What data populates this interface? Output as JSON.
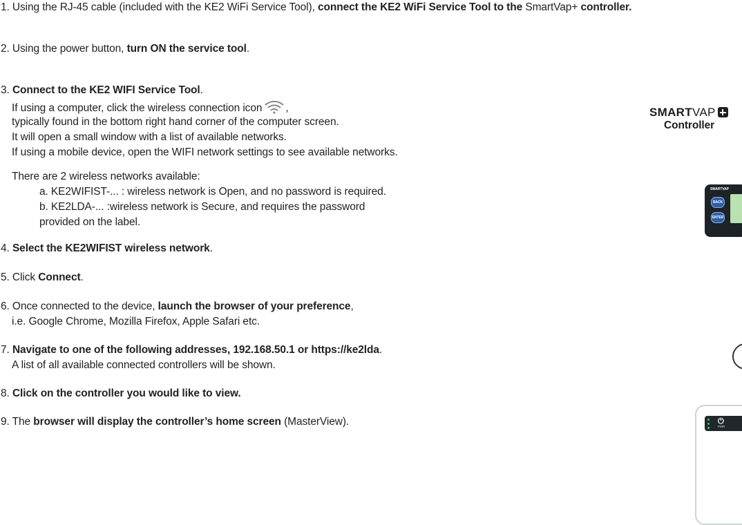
{
  "steps": {
    "s1": {
      "a": "1. Using the RJ-45 cable (included with the KE2 WiFi Service Tool), ",
      "b": "connect the KE2 WiFi Service Tool to the",
      "c": " SmartVap+ ",
      "d": "controller."
    },
    "s2": {
      "a": "2. Using the power button, ",
      "b": "turn ON the service tool",
      "c": "."
    },
    "s3": {
      "num": "3. ",
      "title": "Connect to the KE2 WIFI Service Tool",
      "title_end": ".",
      "p1a": "If using a computer, click the wireless connection icon",
      "p1b": ",",
      "p2": "typically found in the bottom right hand corner of the computer screen.",
      "p3": "It will open a small window with a list of available networks.",
      "p4": "If using a mobile device, open the WIFI network settings to see available networks.",
      "p5": "There are 2 wireless networks available:",
      "opt_a": "a.  KE2WIFIST-... : wireless network is Open, and no password is required.",
      "opt_b": "b.  KE2LDA-... :wireless network is Secure, and requires the password",
      "opt_b2": "provided on the label."
    },
    "s4": {
      "a": "4. ",
      "b": "Select the KE2WIFIST wireless network",
      "c": "."
    },
    "s5": {
      "a": "5. Click ",
      "b": "Connect",
      "c": "."
    },
    "s6": {
      "a": "6. Once connected to the device, ",
      "b": "launch the browser of your preference",
      "c": ",",
      "l2": "i.e. Google Chrome, Mozilla Firefox, Apple Safari etc."
    },
    "s7": {
      "a": "7. ",
      "b": "Navigate to one of the following addresses, 192.168.50.1 or https://ke2lda",
      "c": ".",
      "l2": "A list of all available connected controllers will be shown."
    },
    "s8": {
      "a": "8. ",
      "b": "Click on the controller you would like to view."
    },
    "s9": {
      "a": "9. The ",
      "b": "browser will display the controller’s home screen",
      "c": " (MasterView)."
    }
  },
  "brand": {
    "name_bold": "SMART",
    "name_light": "VAP",
    "subtitle": "Controller"
  },
  "device": {
    "header": "SMARTVAP",
    "back": "BACK",
    "enter": "ENTER"
  },
  "tool": {
    "pwr_icon": "⏻",
    "pwr_label": "PWR"
  },
  "icons": {
    "wifi": "wifi-icon",
    "plus": "plus-box-icon",
    "power": "power-icon"
  },
  "colors": {
    "text": "#222222",
    "device_body": "#1e2328",
    "button_blue": "#2f5fa6",
    "screen_green": "#b9e2b0",
    "led_green": "#48c85a"
  }
}
